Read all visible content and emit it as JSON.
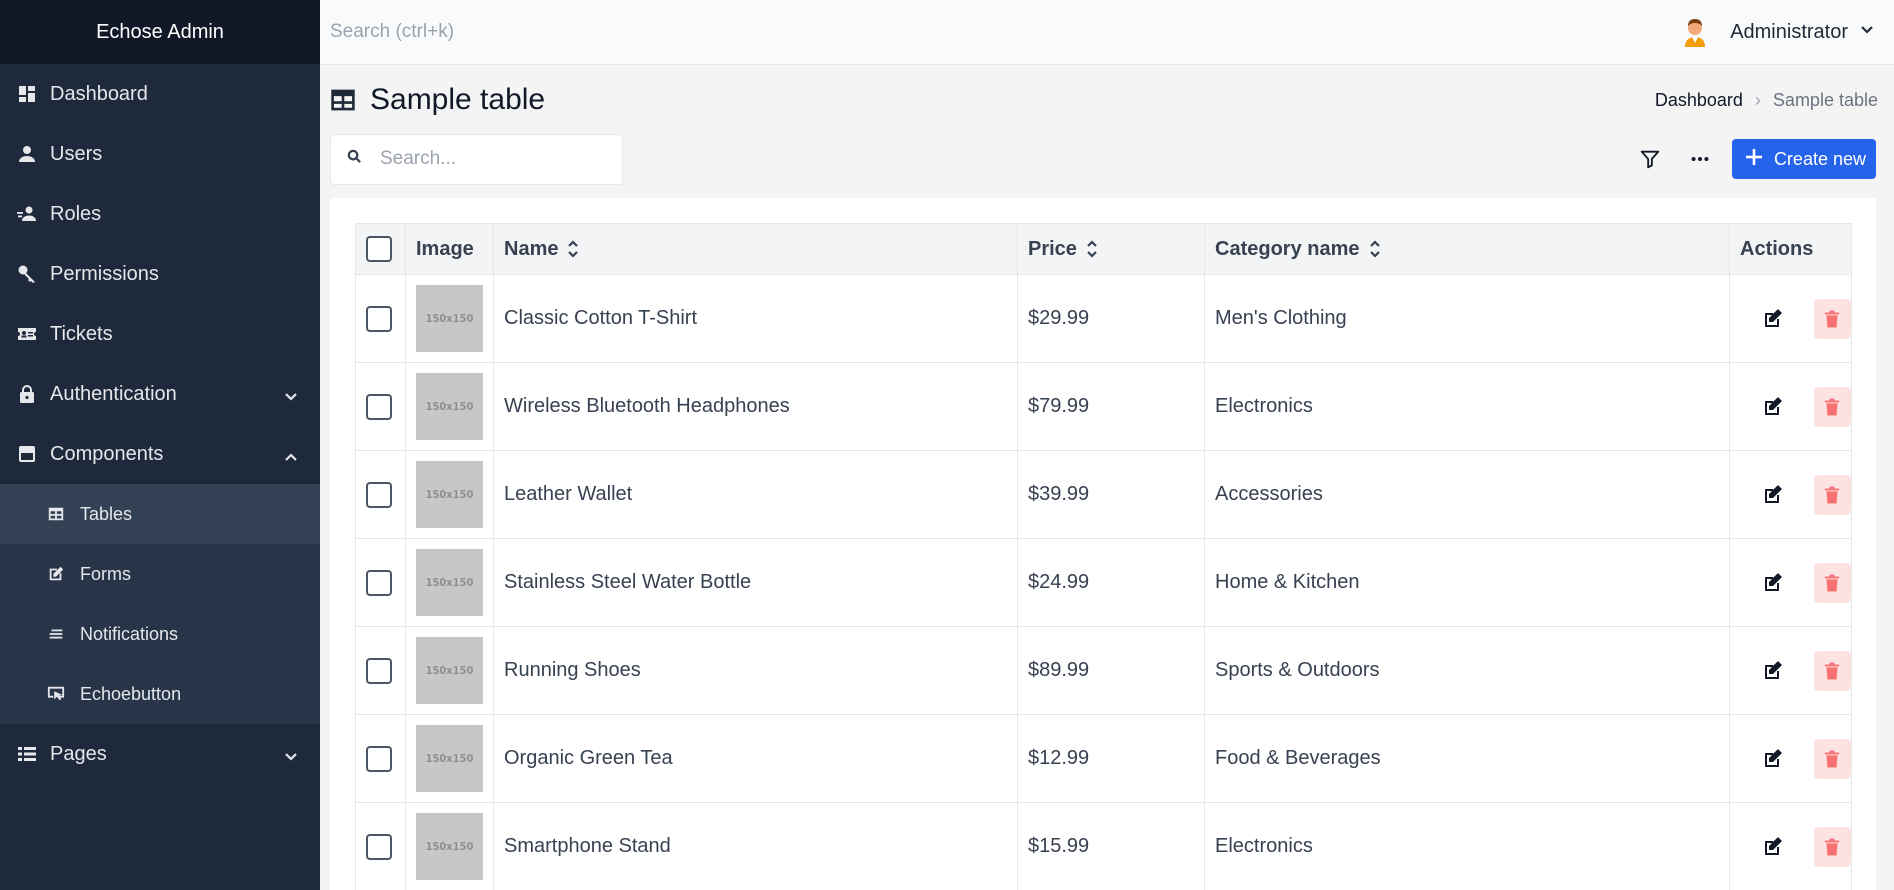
{
  "app": {
    "brand": "Echose Admin"
  },
  "sidebar": {
    "items": [
      {
        "label": "Dashboard"
      },
      {
        "label": "Users"
      },
      {
        "label": "Roles"
      },
      {
        "label": "Permissions"
      },
      {
        "label": "Tickets"
      },
      {
        "label": "Authentication"
      },
      {
        "label": "Components"
      },
      {
        "label": "Pages"
      }
    ],
    "components_children": [
      {
        "label": "Tables",
        "active": true
      },
      {
        "label": "Forms"
      },
      {
        "label": "Notifications"
      },
      {
        "label": "Echoebutton"
      }
    ]
  },
  "topbar": {
    "search_placeholder": "Search (ctrl+k)",
    "user_name": "Administrator"
  },
  "page": {
    "title": "Sample table",
    "breadcrumb": {
      "link": "Dashboard",
      "separator": "›",
      "current": "Sample table"
    }
  },
  "toolbar": {
    "search_placeholder": "Search...",
    "create_label": "Create new"
  },
  "table": {
    "headers": {
      "image": "Image",
      "name": "Name",
      "price": "Price",
      "category": "Category name",
      "actions": "Actions"
    },
    "thumb_label": "150x150",
    "rows": [
      {
        "name": "Classic Cotton T-Shirt",
        "price": "$29.99",
        "category": "Men's Clothing"
      },
      {
        "name": "Wireless Bluetooth Headphones",
        "price": "$79.99",
        "category": "Electronics"
      },
      {
        "name": "Leather Wallet",
        "price": "$39.99",
        "category": "Accessories"
      },
      {
        "name": "Stainless Steel Water Bottle",
        "price": "$24.99",
        "category": "Home & Kitchen"
      },
      {
        "name": "Running Shoes",
        "price": "$89.99",
        "category": "Sports & Outdoors"
      },
      {
        "name": "Organic Green Tea",
        "price": "$12.99",
        "category": "Food & Beverages"
      },
      {
        "name": "Smartphone Stand",
        "price": "$15.99",
        "category": "Electronics"
      }
    ]
  },
  "colors": {
    "sidebar_bg": "#1e293b",
    "brand_bg": "#111827",
    "accent": "#2563eb",
    "danger_bg": "#fde2e2",
    "danger": "#f87171"
  }
}
